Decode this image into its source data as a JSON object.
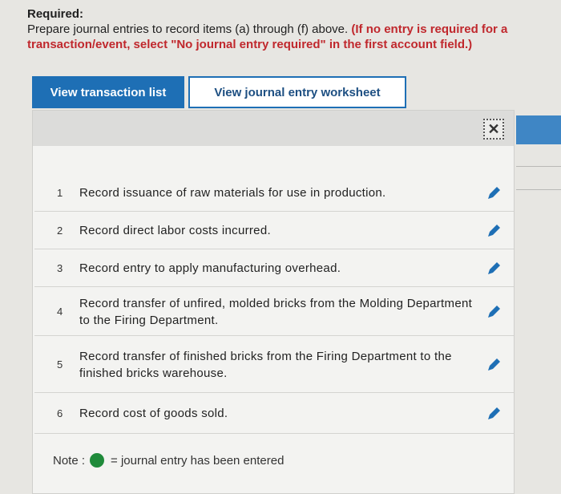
{
  "required": {
    "heading": "Required:",
    "instruction": "Prepare journal entries to record items (a) through (f) above.",
    "warning": "(If no entry is required for a transaction/event, select \"No journal entry required\" in the first account field.)"
  },
  "buttons": {
    "view_transaction_list": "View transaction list",
    "view_journal_entry_worksheet": "View journal entry worksheet"
  },
  "panel": {
    "close_symbol": "✕"
  },
  "transactions": [
    {
      "num": "1",
      "text": "Record issuance of raw materials for use in production."
    },
    {
      "num": "2",
      "text": "Record direct labor costs incurred."
    },
    {
      "num": "3",
      "text": "Record entry to apply manufacturing overhead."
    },
    {
      "num": "4",
      "text": "Record transfer of unfired, molded bricks from the Molding Department to the Firing Department."
    },
    {
      "num": "5",
      "text": "Record transfer of finished bricks from the Firing Department to the finished bricks warehouse."
    },
    {
      "num": "6",
      "text": "Record cost of goods sold."
    }
  ],
  "note": {
    "label": "Note :",
    "text": "= journal entry has been entered",
    "dot_color": "#1f8a3a"
  },
  "colors": {
    "primary": "#1e6fb5",
    "warning": "#c0282d",
    "pencil": "#1e6fb5"
  },
  "icons": {
    "close": "close-icon",
    "edit": "pencil-icon",
    "status": "green-dot-icon"
  }
}
